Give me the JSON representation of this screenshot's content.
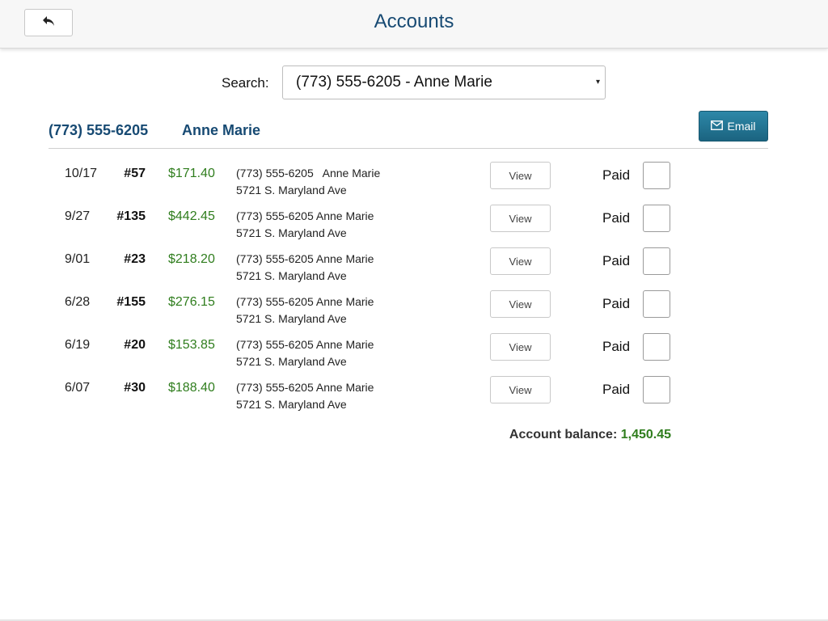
{
  "header": {
    "title": "Accounts",
    "back_icon": "back-arrow-icon"
  },
  "search": {
    "label": "Search:",
    "selected": "(773) 555-6205 - Anne Marie",
    "caret": "▾"
  },
  "account": {
    "phone": "(773) 555-6205",
    "name": "Anne Marie",
    "email_label": "Email",
    "email_icon": "envelope-icon"
  },
  "rows": [
    {
      "date": "10/17",
      "number": "#57",
      "amount": "$171.40",
      "line1": "(773) 555-6205   Anne Marie",
      "line2": "5721 S. Maryland Ave",
      "view": "View",
      "paid": "Paid",
      "checked": false
    },
    {
      "date": "9/27",
      "number": "#135",
      "amount": "$442.45",
      "line1": "(773) 555-6205 Anne Marie",
      "line2": "5721 S. Maryland Ave",
      "view": "View",
      "paid": "Paid",
      "checked": false
    },
    {
      "date": "9/01",
      "number": "#23",
      "amount": "$218.20",
      "line1": "(773) 555-6205 Anne Marie",
      "line2": "5721 S. Maryland Ave",
      "view": "View",
      "paid": "Paid",
      "checked": false
    },
    {
      "date": "6/28",
      "number": "#155",
      "amount": "$276.15",
      "line1": "(773) 555-6205 Anne Marie",
      "line2": "5721 S. Maryland Ave",
      "view": "View",
      "paid": "Paid",
      "checked": false
    },
    {
      "date": "6/19",
      "number": "#20",
      "amount": "$153.85",
      "line1": "(773) 555-6205 Anne Marie",
      "line2": "5721 S. Maryland Ave",
      "view": "View",
      "paid": "Paid",
      "checked": false
    },
    {
      "date": "6/07",
      "number": "#30",
      "amount": "$188.40",
      "line1": "(773) 555-6205 Anne Marie",
      "line2": "5721 S. Maryland Ave",
      "view": "View",
      "paid": "Paid",
      "checked": false
    }
  ],
  "balance": {
    "label": "Account balance:",
    "value": "1,450.45"
  },
  "colors": {
    "title": "#174a73",
    "amount": "#2f7d1d",
    "email_button": "#1f6f8d"
  }
}
